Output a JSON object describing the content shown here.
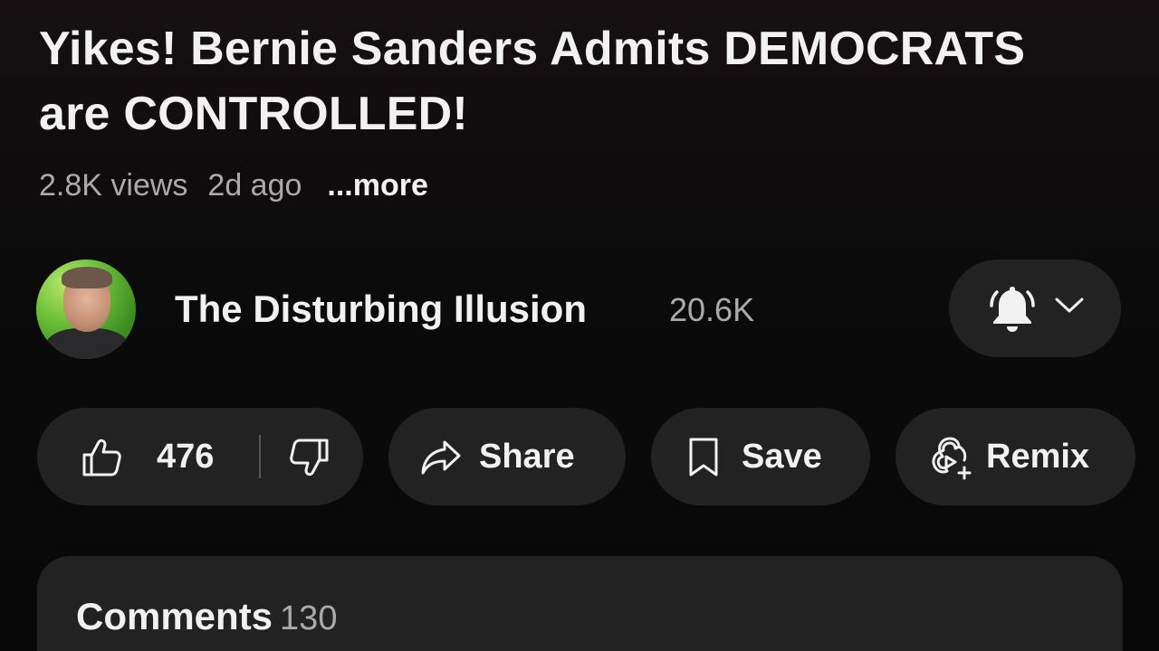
{
  "video": {
    "title": "Yikes! Bernie Sanders Admits DEMOCRATS are CONTROLLED!",
    "views": "2.8K views",
    "age": "2d ago",
    "more_label": "...more"
  },
  "channel": {
    "name": "The Disturbing Illusion",
    "subscribers": "20.6K",
    "avatar_icon": "channel-avatar",
    "notification_icon": "bell-filled-icon",
    "dropdown_icon": "chevron-down-icon"
  },
  "actions": {
    "likes": "476",
    "like_icon": "thumbs-up-icon",
    "dislike_icon": "thumbs-down-icon",
    "share_label": "Share",
    "share_icon": "share-arrow-icon",
    "save_label": "Save",
    "save_icon": "bookmark-icon",
    "remix_label": "Remix",
    "remix_icon": "remix-icon"
  },
  "comments": {
    "label": "Comments",
    "count": "130"
  },
  "colors": {
    "background": "#0b0b0b",
    "pill": "#222222",
    "text_primary": "#f1f1f1",
    "text_secondary": "#aaaaaa"
  }
}
